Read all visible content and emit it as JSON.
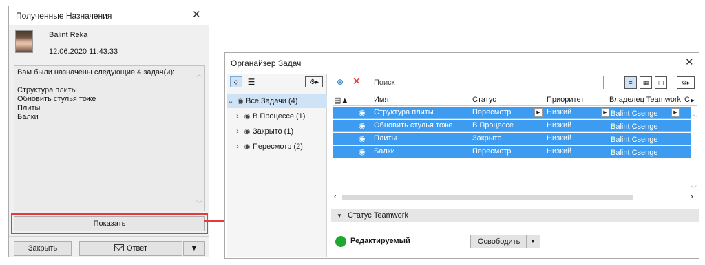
{
  "received": {
    "title": "Полученные Назначения",
    "user_name": "Balint Reka",
    "date": "12.06.2020 11:43:33",
    "message_lines": [
      "Вам были назначены следующие 4 задач(и):",
      "",
      "Структура плиты",
      "Обновить стулья тоже",
      "Плиты",
      "Балки"
    ],
    "show_label": "Показать",
    "close_label": "Закрыть",
    "answer_label": "Ответ"
  },
  "organizer": {
    "title": "Органайзер Задач",
    "search_placeholder": "Поиск",
    "tree": [
      {
        "label": "Все Задачи (4)",
        "expanded": true,
        "selected": true
      },
      {
        "label": "В Процессе (1)",
        "expanded": false,
        "selected": false
      },
      {
        "label": "Закрыто (1)",
        "expanded": false,
        "selected": false
      },
      {
        "label": "Пересмотр (2)",
        "expanded": false,
        "selected": false
      }
    ],
    "columns": [
      "Имя",
      "Статус",
      "Приоритет",
      "Владелец Teamwork",
      "С"
    ],
    "rows": [
      {
        "name": "Структура плиты",
        "status": "Пересмотр",
        "priority": "Низкий",
        "owner": "Balint Csenge"
      },
      {
        "name": "Обновить стулья тоже",
        "status": "В Процессе",
        "priority": "Низкий",
        "owner": "Balint Csenge"
      },
      {
        "name": "Плиты",
        "status": "Закрыто",
        "priority": "Низкий",
        "owner": "Balint Csenge"
      },
      {
        "name": "Балки",
        "status": "Пересмотр",
        "priority": "Низкий",
        "owner": "Balint Csenge"
      }
    ],
    "section_title": "Статус Teamwork",
    "status_text": "Редактируемый",
    "free_label": "Освободить"
  },
  "colors": {
    "selection": "#3d9cf0",
    "highlight_red": "#e43a3a",
    "status_green": "#1fa831"
  }
}
